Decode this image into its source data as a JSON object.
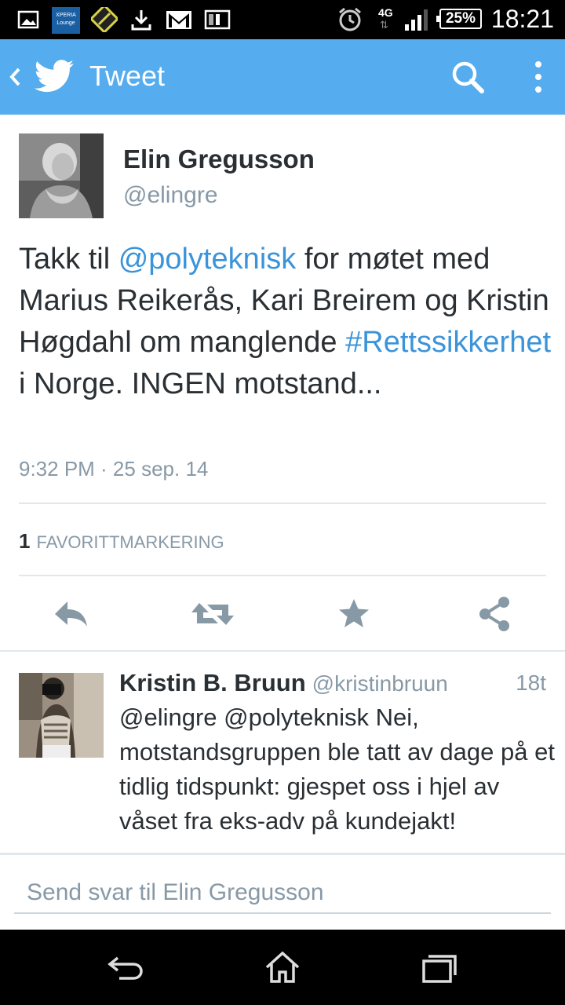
{
  "status_bar": {
    "time": "18:21",
    "battery": "25%",
    "network": "4G",
    "icons": [
      "image-icon",
      "xperia-lounge-icon",
      "app-icon",
      "download-icon",
      "gmail-icon",
      "info-icon",
      "alarm-icon",
      "signal-icon",
      "battery-icon"
    ],
    "xperia_label_1": "XPERIA",
    "xperia_label_2": "Lounge"
  },
  "app_bar": {
    "title": "Tweet",
    "accent_color": "#55acee"
  },
  "tweet": {
    "author_name": "Elin Gregusson",
    "author_handle": "@elingre",
    "text_parts": {
      "p1": "Takk til ",
      "link1": "@polyteknisk",
      "p2": " for møtet med Marius Reikerås, Kari Breirem og Kristin Høgdahl om manglende ",
      "link2": "#Rettssikkerhet",
      "p3": " i Norge. INGEN motstand..."
    },
    "timestamp": "9:32 PM · 25 sep. 14",
    "favorites_count": "1",
    "favorites_label": "FAVORITTMARKERING",
    "actions": [
      "reply-icon",
      "retweet-icon",
      "favorite-icon",
      "share-icon"
    ]
  },
  "reply": {
    "author_name": "Kristin B. Bruun",
    "author_handle": "@kristinbruun",
    "time": "18t",
    "text": "@elingre @polyteknisk Nei, motstandsgruppen ble tatt av dage på et tidlig tidspunkt: gjespet oss i hjel av våset fra eks-adv på kundejakt!"
  },
  "reply_input": {
    "placeholder": "Send svar til Elin Gregusson"
  },
  "nav_bar": {
    "icons": [
      "back-nav-icon",
      "home-icon",
      "recent-apps-icon"
    ]
  }
}
